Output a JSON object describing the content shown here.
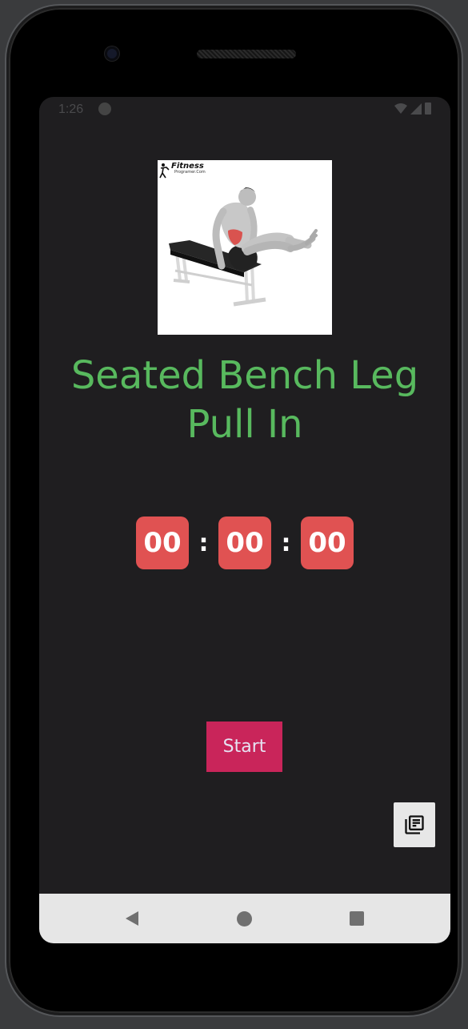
{
  "status_bar": {
    "time": "1:26",
    "app_icon": "app-notification-icon",
    "icons": [
      "wifi-icon",
      "signal-icon",
      "battery-icon"
    ]
  },
  "exercise": {
    "image_icon": "exercise-illustration",
    "logo_title": "Fitness",
    "logo_subtitle": "Programer.Com",
    "title": "Seated Bench Leg Pull In"
  },
  "timer": {
    "hours": "00",
    "minutes": "00",
    "seconds": "00",
    "separator": ":"
  },
  "actions": {
    "start_label": "Start",
    "library_icon": "library-books-icon"
  },
  "nav": {
    "back_icon": "back-icon",
    "home_icon": "home-icon",
    "recents_icon": "recents-icon"
  },
  "colors": {
    "background": "#1f1e20",
    "title": "#58b95e",
    "timer_box": "#e05252",
    "start_button": "#c9255a",
    "navbar": "#e6e6e6"
  }
}
